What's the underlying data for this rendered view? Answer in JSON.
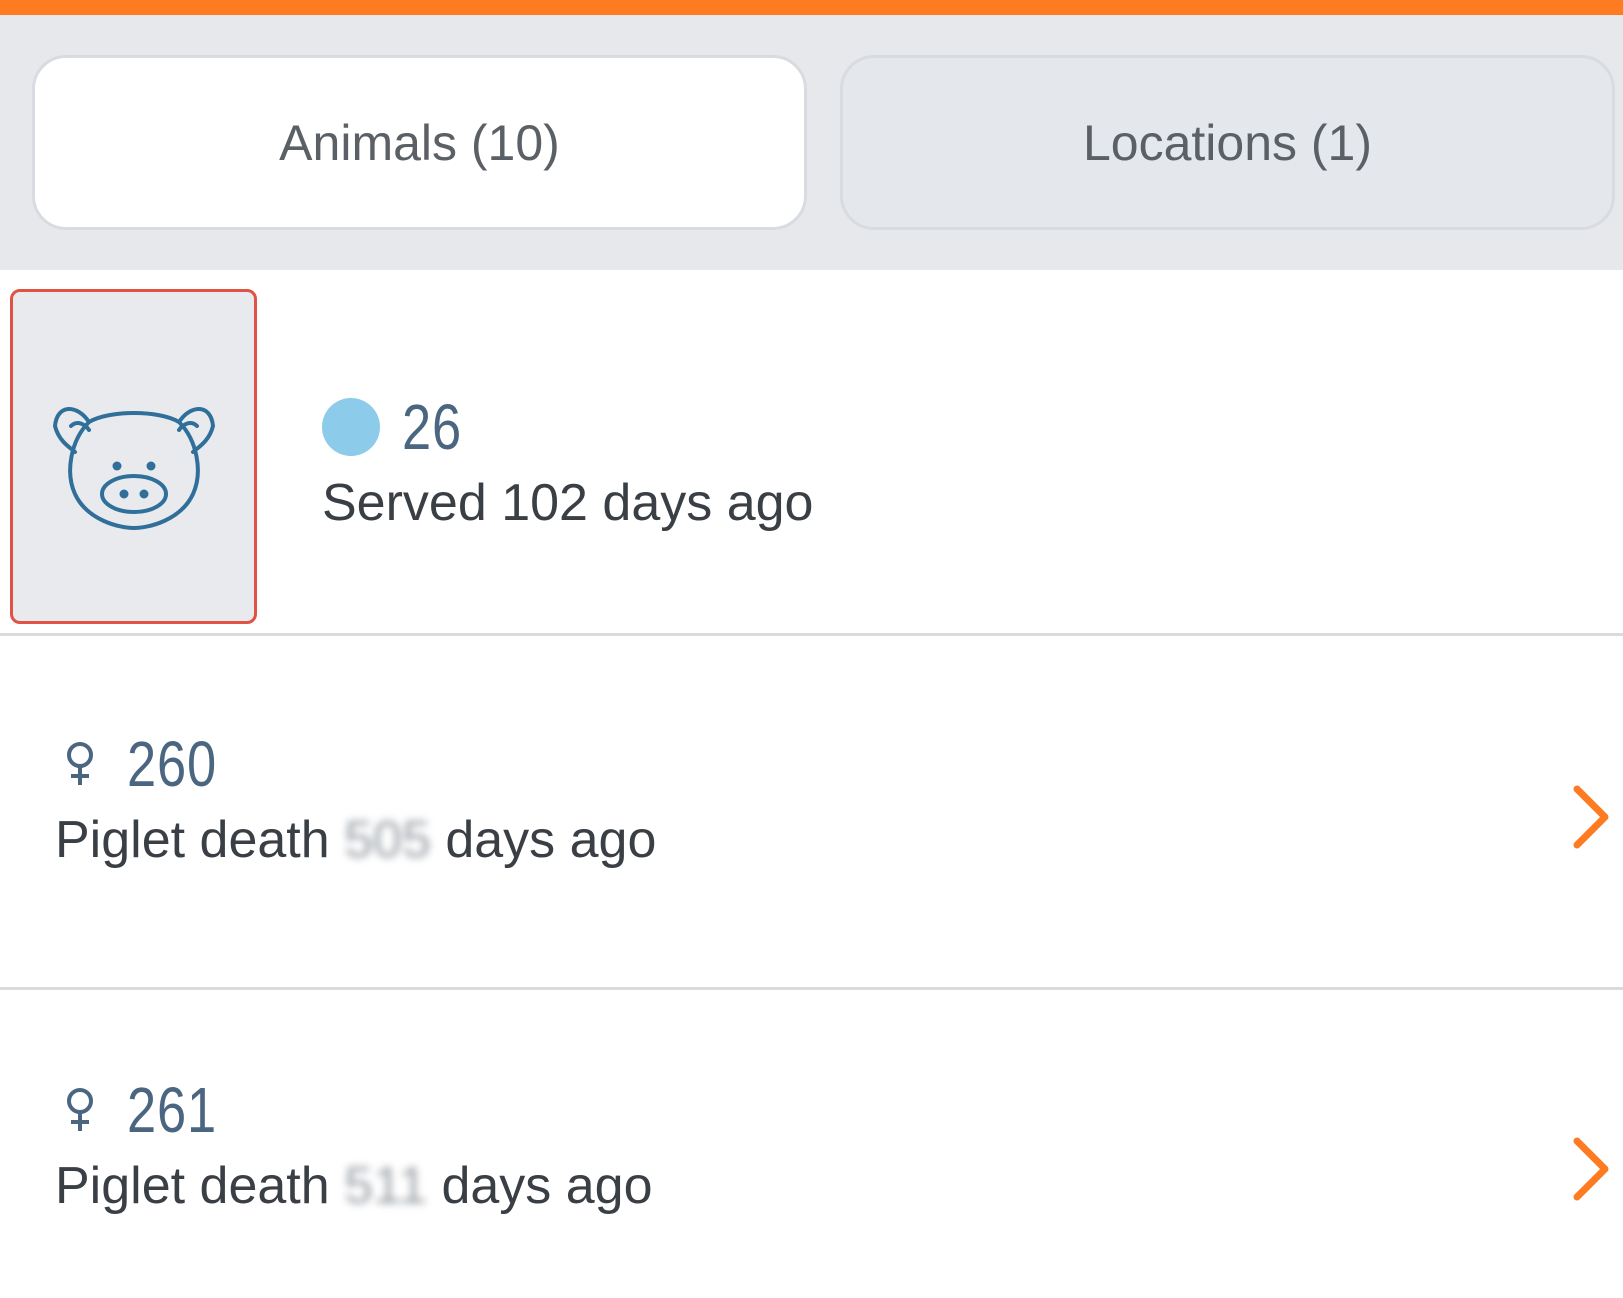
{
  "tabs": {
    "animals_label": "Animals (10)",
    "locations_label": "Locations (1)"
  },
  "rows": [
    {
      "id": "26",
      "status_color": "#8ccbea",
      "subtitle": "Served 102 days ago"
    },
    {
      "id": "260",
      "sex_icon": "female-icon",
      "event": "Piglet death",
      "days": "505",
      "days_suffix": "days ago"
    },
    {
      "id": "261",
      "sex_icon": "female-icon",
      "event": "Piglet death",
      "days": "511",
      "days_suffix": "days ago"
    }
  ],
  "colors": {
    "accent": "#ff7b22",
    "id_text": "#4b6680",
    "icon_blue": "#2f6f9a",
    "highlight_border": "#e05243"
  }
}
